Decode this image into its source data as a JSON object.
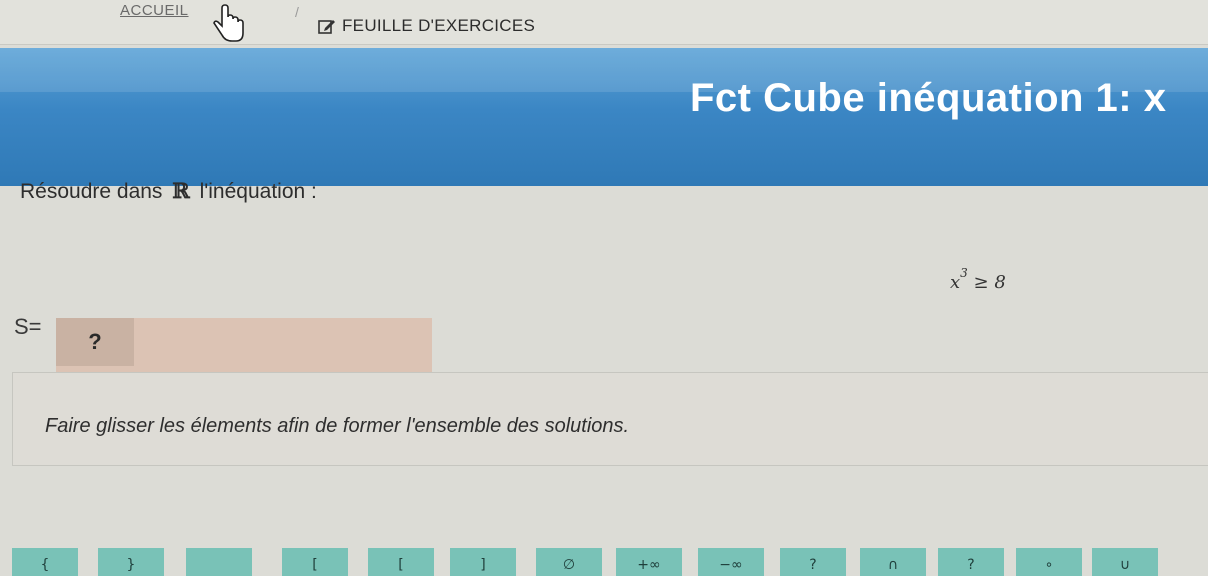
{
  "breadcrumb": {
    "home_label": "ACCUEIL",
    "separator": "/",
    "current_label": "FEUILLE D'EXERCICES"
  },
  "icons": {
    "edit": "edit-icon",
    "cursor": "hand-pointer-icon"
  },
  "header": {
    "title": "Fct Cube inéquation 1: x"
  },
  "exercise": {
    "prompt_before": "Résoudre dans",
    "reals_symbol": "ℝ",
    "prompt_after": "l'inéquation :",
    "equation_base": "x",
    "equation_exponent": "3",
    "equation_rest": " ≥ 8",
    "solution_label": "S=",
    "answer_placeholder": "?",
    "instruction": "Faire glisser les élements afin de former l'ensemble des solutions."
  },
  "tiles": [
    "{",
    "}",
    "",
    "[",
    "[",
    "]",
    "∅",
    "+∞",
    "−∞",
    "?",
    "∩",
    "?",
    "∘",
    "∪"
  ],
  "colors": {
    "banner": "#3b86c4",
    "answer_box": "#dcc3b4",
    "tile": "#79c2b7",
    "background": "#dcdcd6"
  }
}
